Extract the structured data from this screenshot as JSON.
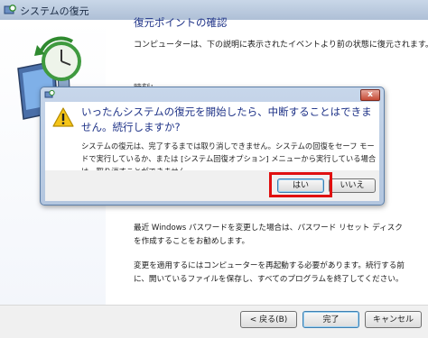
{
  "window": {
    "title": "システムの復元"
  },
  "wizard": {
    "heading": "復元ポイントの確認",
    "intro": "コンピューターは、下の説明に表示されたイベントより前の状態に復元されます。",
    "obscured_line": "時刻：",
    "paragraph1": "最近 Windows パスワードを変更した場合は、パスワード リセット ディスクを作成することをお勧めします。",
    "paragraph2": "変更を適用するにはコンピューターを再起動する必要があります。続行する前に、開いているファイルを保存し、すべてのプログラムを終了してください。"
  },
  "buttons": {
    "back": "< 戻る(B)",
    "finish": "完了",
    "cancel": "キャンセル"
  },
  "dialog": {
    "close_glyph": "x",
    "main_instruction": "いったんシステムの復元を開始したら、中断することはできません。続行しますか?",
    "content": "システムの復元は、完了するまでは取り消しできません。システムの回復をセーフ モードで実行しているか、または [システム回復オプション] メニューから実行している場合は、取り消すことができません。",
    "yes": "はい",
    "no": "いいえ"
  },
  "colors": {
    "highlight": "#e01010",
    "heading": "#1e3287"
  }
}
